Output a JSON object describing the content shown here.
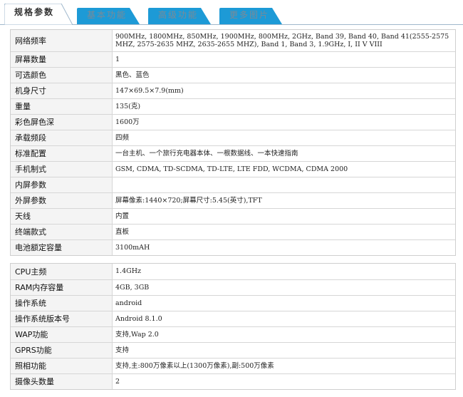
{
  "tabs": [
    {
      "label": "规格参数"
    },
    {
      "label": "基本功能"
    },
    {
      "label": "高级功能"
    },
    {
      "label": "更多图片"
    }
  ],
  "spec_block_1": [
    {
      "key": "网络频率",
      "value": "900MHz, 1800MHz, 850MHz, 1900MHz, 800MHz, 2GHz, Band 39, Band 40, Band 41(2555-2575 MHZ, 2575-2635 MHZ, 2635-2655 MHZ), Band 1, Band 3, 1.9GHz, I, II  V  VIII"
    },
    {
      "key": "屏幕数量",
      "value": "1"
    },
    {
      "key": "可选颜色",
      "value": "黑色、蓝色"
    },
    {
      "key": "机身尺寸",
      "value": "147×69.5×7.9(mm)"
    },
    {
      "key": "重量",
      "value": "135(克)"
    },
    {
      "key": "彩色屏色深",
      "value": "1600万"
    },
    {
      "key": "承载频段",
      "value": "四频"
    },
    {
      "key": "标准配置",
      "value": "一台主机、一个旅行充电器本体、一根数据线、一本快速指南"
    },
    {
      "key": "手机制式",
      "value": "GSM, CDMA, TD-SCDMA, TD-LTE, LTE FDD, WCDMA, CDMA 2000"
    },
    {
      "key": "内屏参数",
      "value": ""
    },
    {
      "key": "外屏参数",
      "value": "屏幕像素:1440×720;屏幕尺寸:5.45(英寸),TFT"
    },
    {
      "key": "天线",
      "value": "内置"
    },
    {
      "key": "终端款式",
      "value": "直板"
    },
    {
      "key": "电池额定容量",
      "value": "3100mAH"
    }
  ],
  "spec_block_2": [
    {
      "key": "CPU主频",
      "value": "1.4GHz"
    },
    {
      "key": "RAM内存容量",
      "value": "4GB, 3GB"
    },
    {
      "key": "操作系统",
      "value": "android"
    },
    {
      "key": "操作系统版本号",
      "value": "Android 8.1.0"
    },
    {
      "key": "WAP功能",
      "value": "支持,Wap 2.0"
    },
    {
      "key": "GPRS功能",
      "value": "支持"
    },
    {
      "key": "照相功能",
      "value": "支持,主:800万像素以上(1300万像素),副:500万像素"
    },
    {
      "key": "摄像头数量",
      "value": "2"
    }
  ],
  "colors": {
    "active_tab": "#ffffff",
    "inactive_tab": "#1d9ad6",
    "tab_border": "#9fb7cc",
    "key_cell_bg": "#f4f4f4"
  }
}
